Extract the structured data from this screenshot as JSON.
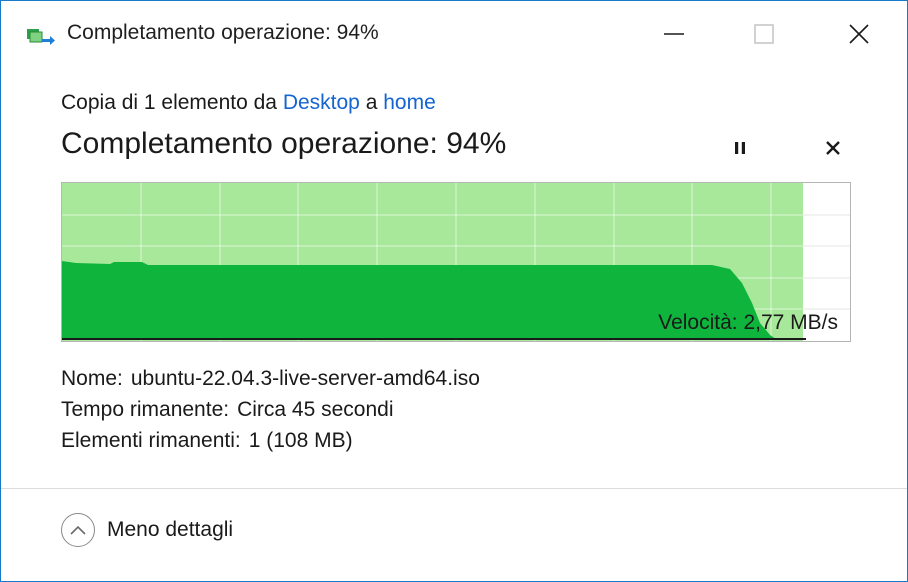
{
  "window": {
    "title": "Completamento operazione: 94%"
  },
  "header": {
    "subtitle_prefix": "Copia di 1 elemento da ",
    "source": "Desktop",
    "subtitle_mid": " a ",
    "destination": "home",
    "status": "Completamento operazione: 94%",
    "progress_fraction": 0.94
  },
  "graph": {
    "speed_text": "Velocità: 2,77 MB/s",
    "colors": {
      "progress_fill": "#a8e89a",
      "speed_fill": "#0fb43c",
      "line": "#1a1a1a"
    }
  },
  "details": {
    "name_label": "Nome:",
    "name_value": "ubuntu-22.04.3-live-server-amd64.iso",
    "time_label": "Tempo rimanente:",
    "time_value": "Circa 45 secondi",
    "items_label": "Elementi rimanenti:",
    "items_value": "1 (108 MB)"
  },
  "footer": {
    "toggle_label": "Meno dettagli"
  },
  "icons": {
    "app": "copy-files-icon",
    "pause": "pause-icon",
    "cancel": "close-icon",
    "toggle": "chevron-up-icon"
  }
}
